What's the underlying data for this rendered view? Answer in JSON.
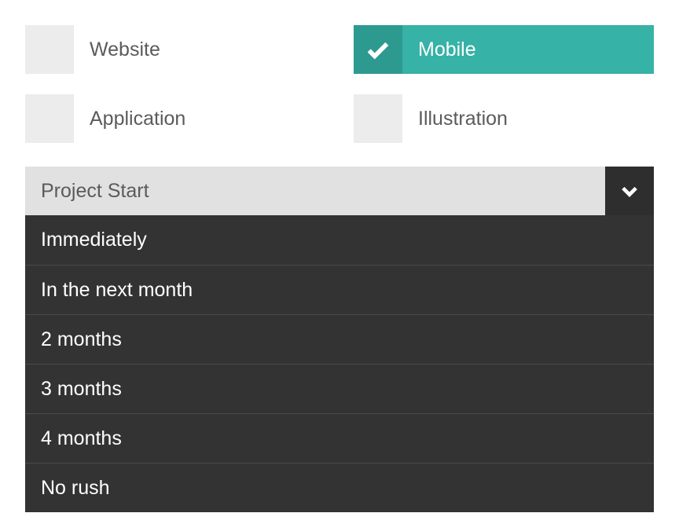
{
  "options": [
    {
      "label": "Website",
      "selected": false
    },
    {
      "label": "Mobile",
      "selected": true
    },
    {
      "label": "Application",
      "selected": false
    },
    {
      "label": "Illustration",
      "selected": false
    }
  ],
  "dropdown": {
    "title": "Project Start",
    "items": [
      "Immediately",
      "In the next month",
      "2 months",
      "3 months",
      "4 months",
      "No rush"
    ]
  },
  "colors": {
    "accent": "#36b2a6",
    "accent_dark": "#2d9a8f",
    "dark": "#333333",
    "light_gray": "#e1e1e1",
    "box_gray": "#ececec",
    "text": "#5b5b5b"
  }
}
